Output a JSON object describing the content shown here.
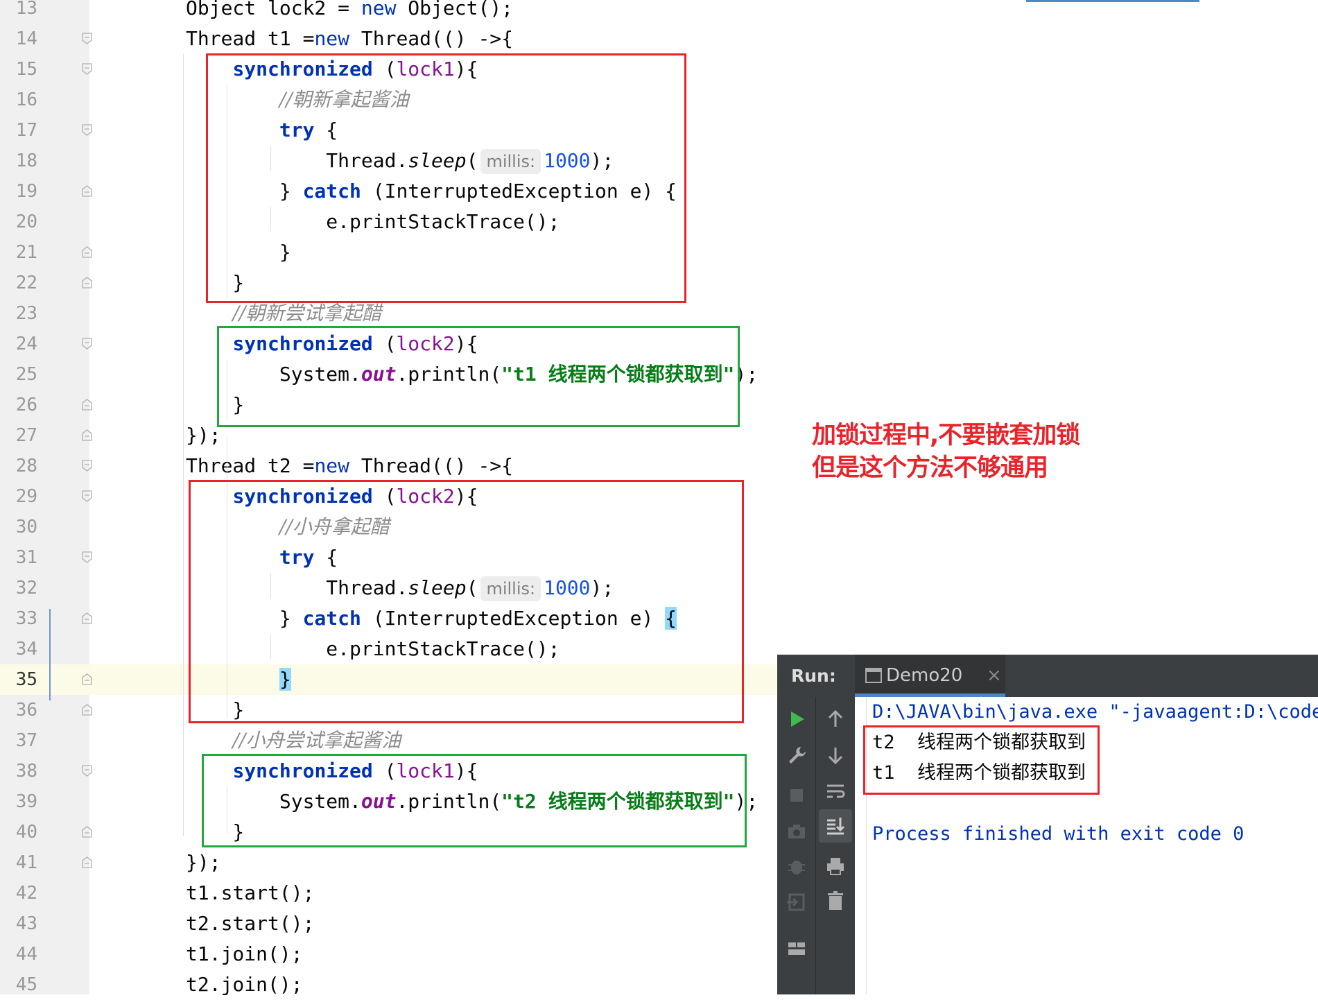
{
  "editor": {
    "current_line": 35,
    "lines": [
      {
        "num": "13",
        "html": "Object lock2 = <span class=\"k2\">new</span> Object();"
      },
      {
        "num": "14",
        "html": "Thread t1 =<span class=\"k2\">new</span> Thread(() -&gt;{"
      },
      {
        "num": "15",
        "html": "    <span class=\"k\">synchronized</span> (<span class=\"l2\">lock1</span>){"
      },
      {
        "num": "16",
        "html": "        <span class=\"c\">//朝新拿起酱油</span>"
      },
      {
        "num": "17",
        "html": "        <span class=\"k\">try</span> {"
      },
      {
        "num": "18",
        "html": "            Thread.<span class=\"m\">sleep</span>(<span class=\"hint\">millis:</span><span class=\"n\">1000</span>);"
      },
      {
        "num": "19",
        "html": "        } <span class=\"k\">catch</span> (InterruptedException e) {"
      },
      {
        "num": "20",
        "html": "            e.printStackTrace();"
      },
      {
        "num": "21",
        "html": "        }"
      },
      {
        "num": "22",
        "html": "    }"
      },
      {
        "num": "23",
        "html": "    <span class=\"c\">//朝新尝试拿起醋</span>"
      },
      {
        "num": "24",
        "html": "    <span class=\"k\">synchronized</span> (<span class=\"l2\">lock2</span>){"
      },
      {
        "num": "25",
        "html": "        System.<span class=\"f\">out</span>.println(<span class=\"s\">\"t1 线程两个锁都获取到\"</span>);"
      },
      {
        "num": "26",
        "html": "    }"
      },
      {
        "num": "27",
        "html": "});"
      },
      {
        "num": "28",
        "html": "Thread t2 =<span class=\"k2\">new</span> Thread(() -&gt;{"
      },
      {
        "num": "29",
        "html": "    <span class=\"k\">synchronized</span> (<span class=\"l2\">lock2</span>){"
      },
      {
        "num": "30",
        "html": "        <span class=\"c\">//小舟拿起醋</span>"
      },
      {
        "num": "31",
        "html": "        <span class=\"k\">try</span> {"
      },
      {
        "num": "32",
        "html": "            Thread.<span class=\"m\">sleep</span>(<span class=\"hint\">millis:</span><span class=\"n\">1000</span>);"
      },
      {
        "num": "33",
        "html": "        } <span class=\"k\">catch</span> (InterruptedException e) <span class=\"brace-hl\">{</span>"
      },
      {
        "num": "34",
        "html": "            e.printStackTrace();"
      },
      {
        "num": "35",
        "html": "        <span class=\"brace-hl\">}</span>"
      },
      {
        "num": "36",
        "html": "    }"
      },
      {
        "num": "37",
        "html": "    <span class=\"c\">//小舟尝试拿起酱油</span>"
      },
      {
        "num": "38",
        "html": "    <span class=\"k\">synchronized</span> (<span class=\"l2\">lock1</span>){"
      },
      {
        "num": "39",
        "html": "        System.<span class=\"f\">out</span>.println(<span class=\"s\">\"t2 线程两个锁都获取到\"</span>);"
      },
      {
        "num": "40",
        "html": "    }"
      },
      {
        "num": "41",
        "html": "});"
      },
      {
        "num": "42",
        "html": "t1.start();"
      },
      {
        "num": "43",
        "html": "t2.start();"
      },
      {
        "num": "44",
        "html": "t1.join();"
      },
      {
        "num": "45",
        "html": "t2.join();"
      }
    ]
  },
  "annotation": {
    "line1": "加锁过程中,不要嵌套加锁",
    "line2": "但是这个方法不够通用"
  },
  "run": {
    "label": "Run:",
    "tab_title": "Demo20",
    "tab_close": "×",
    "console": {
      "command": "D:\\JAVA\\bin\\java.exe \"-javaagent:D:\\code",
      "output": [
        "t2  线程两个锁都获取到",
        "t1  线程两个锁都获取到"
      ],
      "finished": "Process finished with exit code 0"
    }
  },
  "colors": {
    "annotation_red": "#e8232a",
    "box_red": "#e8232a",
    "box_green": "#23a83f",
    "keyword": "#0033b3",
    "string": "#067d17",
    "comment": "#8c8c8c",
    "number": "#1750eb",
    "console_bg": "#ffffff",
    "toolbar_bg": "#3c3f41"
  },
  "icons": {
    "toolbar_left": [
      "run-icon",
      "wrench-icon",
      "stop-icon",
      "camera-icon",
      "debug-bug-icon",
      "exit-icon",
      "layout-icon"
    ],
    "toolbar_right": [
      "arrow-up-icon",
      "arrow-down-icon",
      "soft-wrap-icon",
      "scroll-to-end-icon",
      "print-icon",
      "trash-icon"
    ]
  }
}
